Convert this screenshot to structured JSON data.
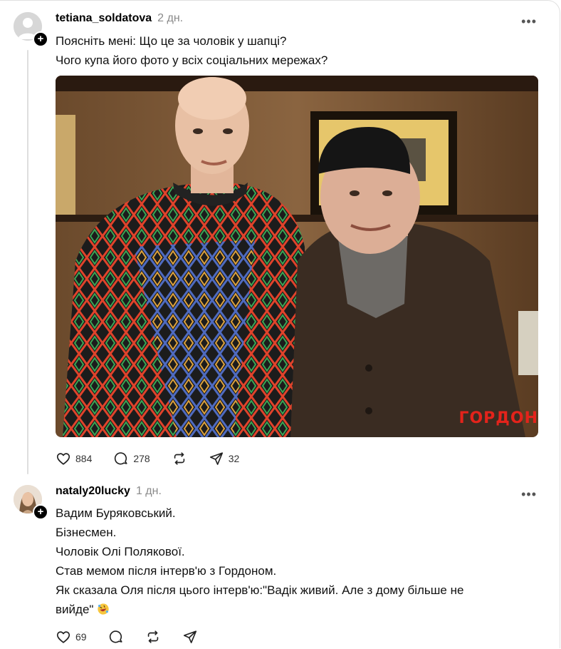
{
  "post": {
    "username": "tetiana_soldatova",
    "timestamp": "2 дн.",
    "more": "•••",
    "lines": [
      "Поясніть мені: Що це за чоловік у шапці?",
      "Чого купа його фото у всіх соціальних мережах?"
    ],
    "image_watermark": "ГОРДОН",
    "likes": "884",
    "comments": "278",
    "shares": "32"
  },
  "reply": {
    "username": "nataly20lucky",
    "timestamp": "1 дн.",
    "more": "•••",
    "lines": [
      "Вадим Буряковський.",
      "Бізнесмен.",
      "Чоловік Олі Полякової.",
      "Став мемом після інтерв'ю з Гордоном.",
      "Як сказала Оля після цього інтерв'ю:\"Вадік живий. Але з дому більше не",
      "вийде\""
    ],
    "emoji": "rolling-on-floor-laughing",
    "likes": "69"
  },
  "badge_symbol": "+"
}
